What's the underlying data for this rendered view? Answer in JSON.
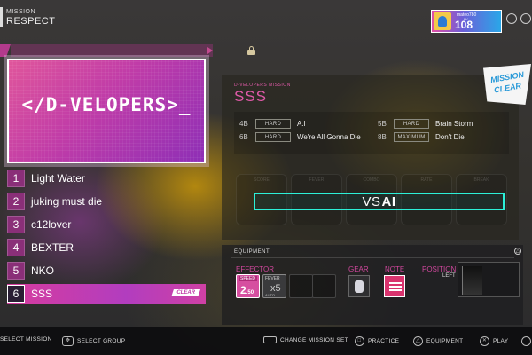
{
  "header": {
    "section": "MISSION",
    "title": "RESPECT",
    "player": {
      "name": "mateo780",
      "level": "108",
      "level_label": "LV"
    }
  },
  "mission_pack": {
    "cover_title": "</D-VELOPERS>_"
  },
  "missions": [
    {
      "num": "1",
      "name": "Light Water"
    },
    {
      "num": "2",
      "name": "juking must die"
    },
    {
      "num": "3",
      "name": "c12lover"
    },
    {
      "num": "4",
      "name": "BEXTER"
    },
    {
      "num": "5",
      "name": "NKO"
    },
    {
      "num": "6",
      "name": "SSS",
      "badge": "CLEAR",
      "selected": true
    }
  ],
  "detail": {
    "subtitle": "D-VELOPERS MISSION",
    "title": "SSS",
    "requirements": [
      {
        "key": "4B",
        "difficulty": "HARD",
        "song": "A.I"
      },
      {
        "key": "5B",
        "difficulty": "HARD",
        "song": "Brain Storm"
      },
      {
        "key": "6B",
        "difficulty": "HARD",
        "song": "We're All Gonna Die"
      },
      {
        "key": "8B",
        "difficulty": "MAXIMUM",
        "song": "Don't Die"
      }
    ],
    "slots": [
      "SCORE",
      "FEVER",
      "COMBO",
      "RATE",
      "BREAK"
    ],
    "vs_prefix": "VS",
    "vs_target": "AI",
    "badge_line1": "MISSION",
    "badge_line2": "CLEAR"
  },
  "equipment": {
    "title": "EQUIPMENT",
    "effector_label": "EFFECTOR",
    "speed_label": "SPEED",
    "speed_value": "2",
    "speed_decimal": ".50",
    "fever_label": "FEVER",
    "fever_value": "x5",
    "fever_mode": "AUTO",
    "gear_label": "GEAR",
    "note_label": "NOTE",
    "position_label": "POSITION",
    "position_value": "LEFT"
  },
  "footer": {
    "select_mission": "SELECT MISSION",
    "select_group": "SELECT GROUP",
    "change_mission_set": "CHANGE MISSION SET",
    "practice": "PRACTICE",
    "equipment": "EQUIPMENT",
    "play": "PLAY"
  },
  "colors": {
    "accent_pink": "#d0479d",
    "accent_cyan": "#2cf0d8",
    "selected_bar": "#c03ca8"
  }
}
